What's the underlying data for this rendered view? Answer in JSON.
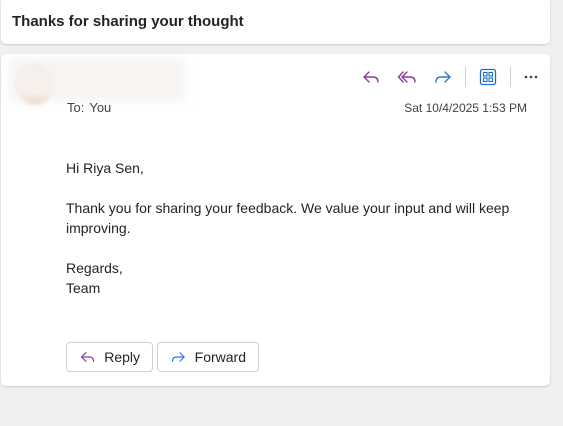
{
  "subject": {
    "title": "Thanks for sharing your thought"
  },
  "message": {
    "to_label": "To:",
    "to_value": "You",
    "date": "Sat 10/4/2025 1:53 PM",
    "body": {
      "greeting": "Hi Riya Sen,",
      "paragraph": "Thank you for sharing your feedback. We value your input and will keep improving.",
      "closing": "Regards,",
      "signature": "Team"
    },
    "buttons": {
      "reply_label": "Reply",
      "forward_label": "Forward"
    }
  },
  "toolbar_icons": [
    "reply-icon",
    "reply-all-icon",
    "forward-icon",
    "apps-icon",
    "more-options-icon"
  ],
  "colors": {
    "reply_purple": "#8b3aa8",
    "forward_blue": "#2b7cd3",
    "apps_blue": "#1f6fc5",
    "background": "#f0f0f0"
  }
}
